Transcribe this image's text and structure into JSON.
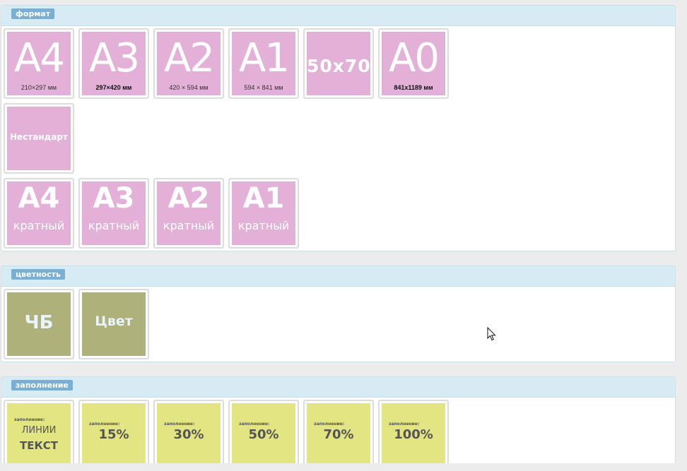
{
  "format": {
    "title": "формат",
    "row1": [
      {
        "big": "A4",
        "dim": "210×297 мм"
      },
      {
        "big": "A3",
        "dim": "297×420  мм"
      },
      {
        "big": "A2",
        "dim": "420 × 594  мм"
      },
      {
        "big": "A1",
        "dim": "594 × 841 мм"
      },
      {
        "mid": "50x70"
      },
      {
        "big": "A0",
        "dim": "841x1189 мм"
      }
    ],
    "nonstandard": "Нестандарт",
    "multiple": [
      {
        "big": "A4",
        "small": "кратный"
      },
      {
        "big": "A3",
        "small": "кратный"
      },
      {
        "big": "A2",
        "small": "кратный"
      },
      {
        "big": "A1",
        "small": "кратный"
      }
    ]
  },
  "color": {
    "title": "цветность",
    "bw": "ЧБ",
    "col": "Цвет"
  },
  "fill": {
    "title": "заполнение",
    "first": {
      "label": "заполнение:",
      "line1": "ЛИНИИ",
      "line2": "ТЕКСТ"
    },
    "items": [
      {
        "label": "заполнение:",
        "value": "15%"
      },
      {
        "label": "заполнение:",
        "value": "30%"
      },
      {
        "label": "заполнение:",
        "value": "50%"
      },
      {
        "label": "заполнение:",
        "value": "70%"
      },
      {
        "label": "заполнение:",
        "value": "100%"
      }
    ]
  },
  "colors": {
    "pink": "#e3b0d7",
    "olive": "#afb17b",
    "yellow": "#e3e583",
    "header": "#d6ebf4",
    "badge": "#7aaed3"
  }
}
